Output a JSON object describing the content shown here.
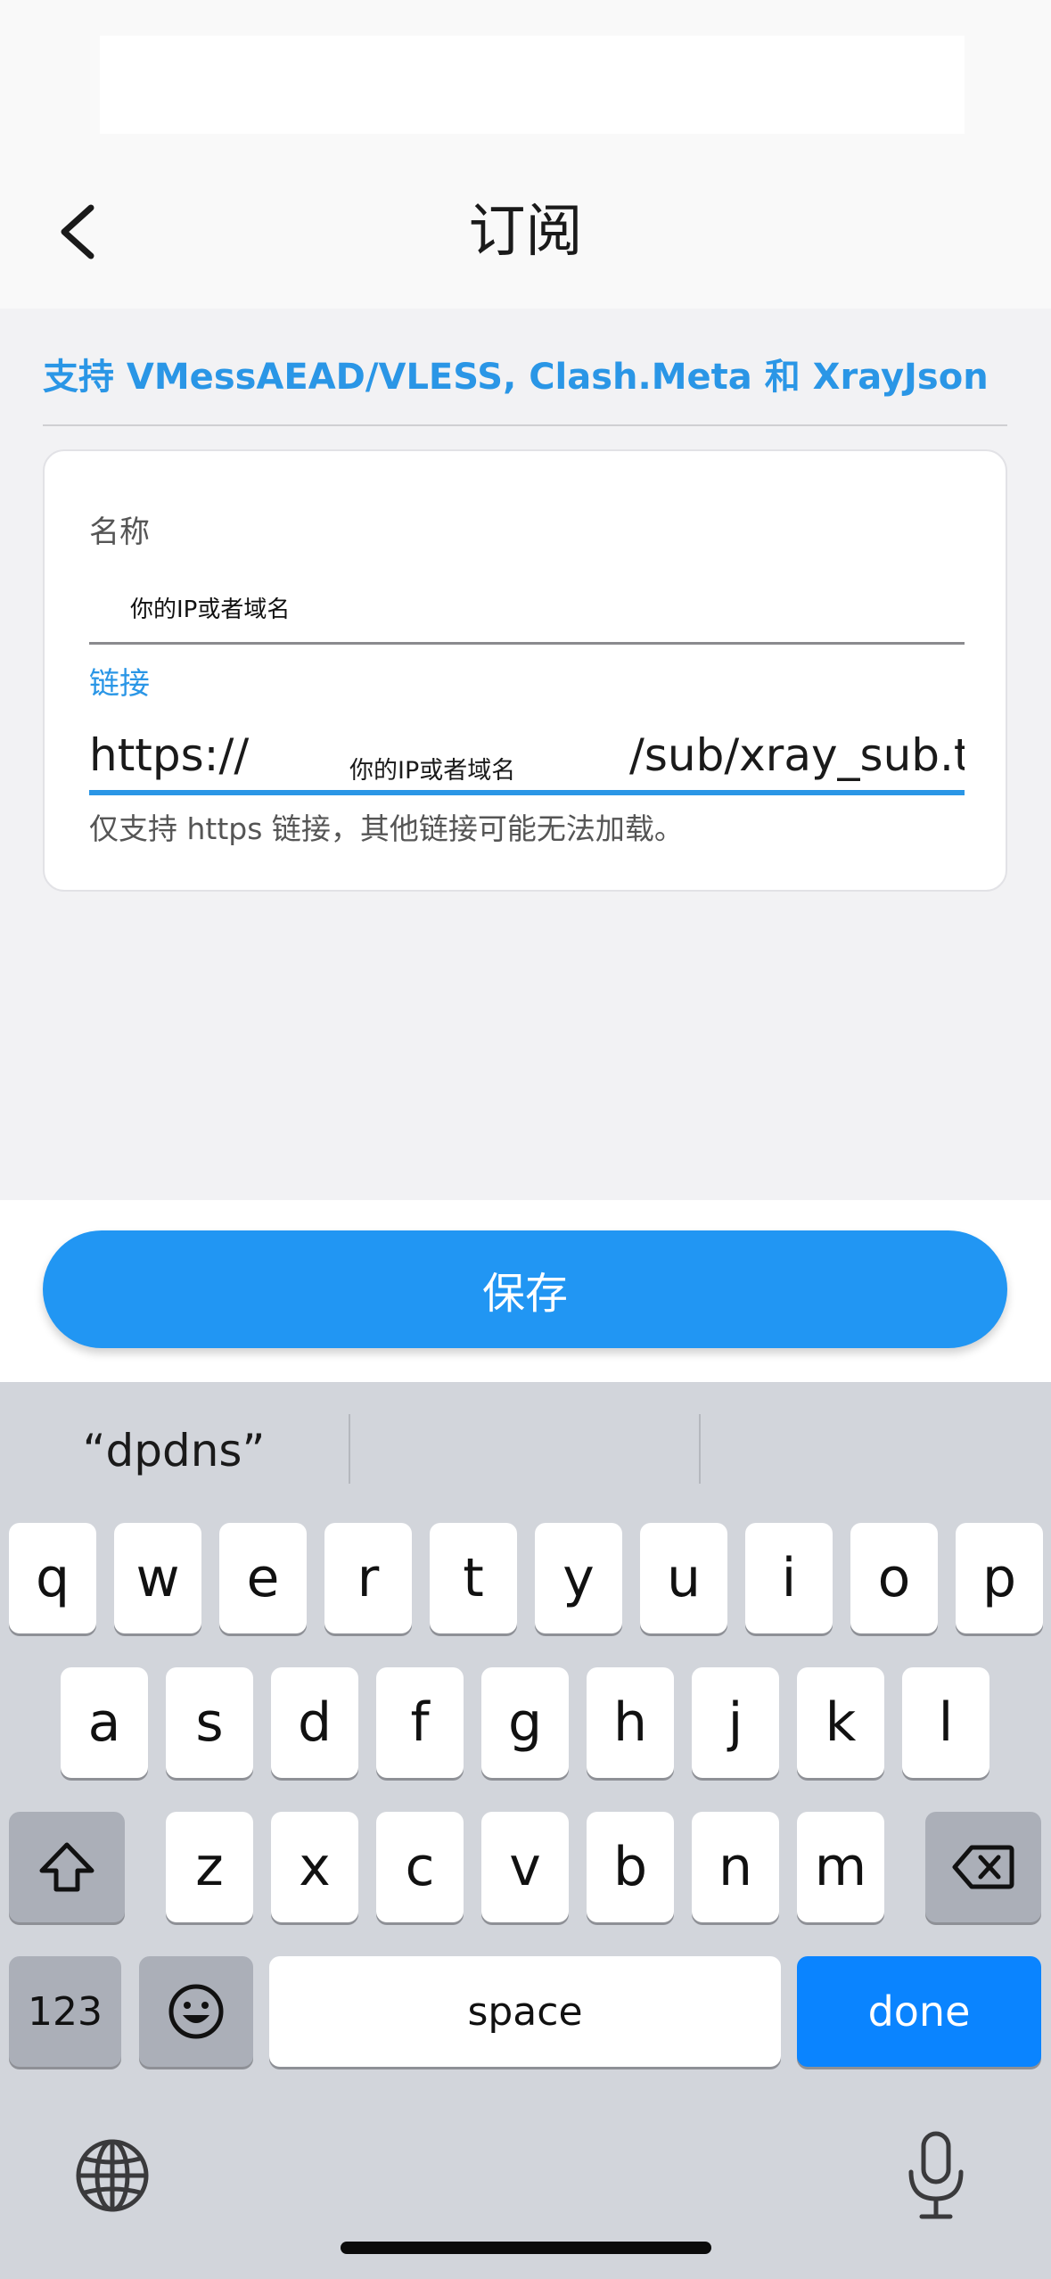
{
  "nav": {
    "title": "订阅",
    "back_icon": "chevron-left-icon"
  },
  "support_text": "支持 VMessAEAD/VLESS, Clash.Meta 和 XrayJson",
  "form": {
    "name_label": "名称",
    "name_value": "你的IP或者域名",
    "link_label": "链接",
    "link_prefix": "https://",
    "link_placeholder_overlay": "你的IP或者域名",
    "link_suffix": "/sub/xray_sub.txt",
    "hint": "仅支持 https 链接，其他链接可能无法加载。"
  },
  "save_button": "保存",
  "keyboard": {
    "suggestions": [
      "“dpdns”",
      "",
      ""
    ],
    "row1": [
      "q",
      "w",
      "e",
      "r",
      "t",
      "y",
      "u",
      "i",
      "o",
      "p"
    ],
    "row2": [
      "a",
      "s",
      "d",
      "f",
      "g",
      "h",
      "j",
      "k",
      "l"
    ],
    "row3": [
      "z",
      "x",
      "c",
      "v",
      "b",
      "n",
      "m"
    ],
    "shift_icon": "shift-icon",
    "backspace_icon": "backspace-icon",
    "numbers_key": "123",
    "emoji_icon": "emoji-icon",
    "space_key": "space",
    "done_key": "done",
    "globe_icon": "globe-icon",
    "mic_icon": "microphone-icon"
  },
  "colors": {
    "accent": "#2196f3",
    "link_blue": "#2a96e6",
    "done_blue": "#0a84ff"
  }
}
